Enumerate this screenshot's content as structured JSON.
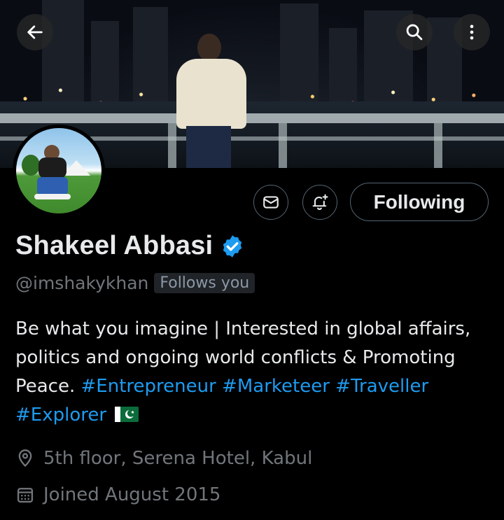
{
  "header": {
    "back_icon": "arrow-left-icon",
    "search_icon": "search-icon",
    "more_icon": "more-vertical-icon"
  },
  "profile": {
    "name": "Shakeel Abbasi",
    "verified": true,
    "handle": "@imshakykhan",
    "follows_you_label": "Follows you",
    "bio_text": "Be what you imagine | Interested in global affairs, politics and ongoing world conflicts & Promoting Peace. ",
    "hashtags": [
      "#Entrepreneur",
      "#Marketeer",
      "#Traveller",
      "#Explorer"
    ],
    "flag": "pakistan-flag-emoji",
    "location": "5th floor, Serena Hotel, Kabul",
    "joined": "Joined August 2015"
  },
  "actions": {
    "message_icon": "envelope-icon",
    "notify_icon": "bell-plus-icon",
    "following_label": "Following"
  },
  "colors": {
    "accent": "#1d9bf0",
    "background": "#000000",
    "text_primary": "#e7e9ea",
    "text_secondary": "#71767b",
    "border": "#536471"
  }
}
